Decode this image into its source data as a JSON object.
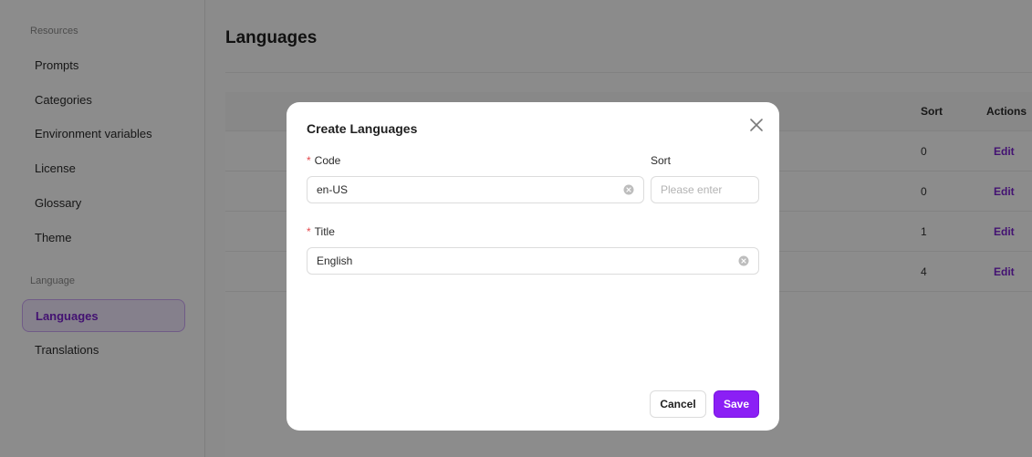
{
  "sidebar": {
    "sections": [
      {
        "label": "Resources"
      },
      {
        "label": "Language"
      }
    ],
    "items": [
      {
        "label": "Prompts"
      },
      {
        "label": "Categories"
      },
      {
        "label": "Environment variables"
      },
      {
        "label": "License"
      },
      {
        "label": "Glossary"
      },
      {
        "label": "Theme"
      },
      {
        "label": "Languages"
      },
      {
        "label": "Translations"
      }
    ],
    "active_item": "Languages"
  },
  "main": {
    "title": "Languages",
    "table": {
      "headers": {
        "sort": "Sort",
        "actions": "Actions"
      },
      "rows": [
        {
          "sort": "0",
          "action": "Edit"
        },
        {
          "sort": "0",
          "action": "Edit"
        },
        {
          "sort": "1",
          "action": "Edit"
        },
        {
          "sort": "4",
          "action": "Edit"
        }
      ]
    }
  },
  "modal": {
    "title": "Create Languages",
    "required_mark": "*",
    "code": {
      "label": "Code",
      "value": "en-US"
    },
    "sort": {
      "label": "Sort",
      "placeholder": "Please enter"
    },
    "title_field": {
      "label": "Title",
      "value": "English"
    },
    "cancel_label": "Cancel",
    "save_label": "Save"
  },
  "colors": {
    "accent": "#8b1ff5",
    "accent_text": "#7b22cf",
    "required": "#e5484d"
  },
  "icons": {
    "close": "close-icon",
    "clear": "clear-circle-icon"
  }
}
